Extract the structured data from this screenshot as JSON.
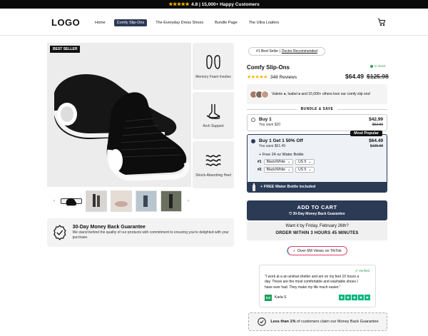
{
  "announcement": {
    "stars": "★★★★★",
    "text": "4.8 | 15,000+ Happy Customers"
  },
  "header": {
    "logo": "LOGO",
    "nav": [
      "Home",
      "Comfy Slip-Ons",
      "The Everyday Dress Shoes",
      "Bundle Page",
      "The Ultra Loafers"
    ],
    "active_nav": "Comfy Slip-Ons",
    "cart_icon": "cart-icon"
  },
  "gallery": {
    "badge": "BEST SELLER",
    "features": [
      "Memory Foam Insoles",
      "Arch Support",
      "Shock-Absorbing Heel"
    ],
    "thumb_count": 5,
    "prev_arrow": "‹",
    "next_arrow": "›"
  },
  "guarantee": {
    "title": "30-Day Money Back Guarantee",
    "desc": "We stand behind the quality of our products with commitment to ensuring you're delighted with your purchase."
  },
  "product": {
    "pill_prefix": "#1 Best Seller |",
    "pill_link": "Doctor Recommended",
    "in_stock": "In stock",
    "title": "Comfy Slip-Ons",
    "stars": "★★★★★",
    "reviews": "348 Reviews",
    "price": "$64.49",
    "compare_price": "$125.98",
    "social_proof": "Valerie ●, Isabel ● and 15,000+ others love our comfy slip ons!"
  },
  "bundle": {
    "header": "BUNDLE & SAVE",
    "option1": {
      "title": "Buy 1",
      "save": "You save $20",
      "price": "$42.99",
      "compare": "$62.99"
    },
    "option2": {
      "badge": "Most Popular",
      "title": "Buy 1 Get 1 50% Off",
      "save": "You save $61.49",
      "price": "$64.49",
      "compare": "$125.98",
      "free_item": "+ Free 24 oz Water Bottle",
      "row1_label": "#1",
      "row2_label": "#2",
      "color_value": "Black/White",
      "size_value": "US 5",
      "bottle_text": "+ FREE Water Bottle included"
    }
  },
  "cta": {
    "label": "ADD TO CART",
    "sub": "30-Day Money Back Guarantee"
  },
  "delivery": {
    "line1": "Want it by Friday, February 26th?",
    "line2": "ORDER WITHIN 3 HOURS 45 MINUTES"
  },
  "tiktok": {
    "text": "Over 6M Views on TikTok"
  },
  "review": {
    "verified": "Verified",
    "quote": "\"I work at a an animal shelter and am on my feet 10 hours a day. These are the most comfortable and washable shoes I have ever had. They make my life much easier.\"",
    "initials": "KS",
    "name": "Karla S"
  },
  "claim": {
    "bold": "Less than 1%",
    "text": "of customers claim our Money Back Guarantee"
  },
  "colors": {
    "accent": "#2b3a55",
    "star": "#f4b400",
    "green": "#2e9e4f",
    "tiktok": "#e03e6b"
  }
}
